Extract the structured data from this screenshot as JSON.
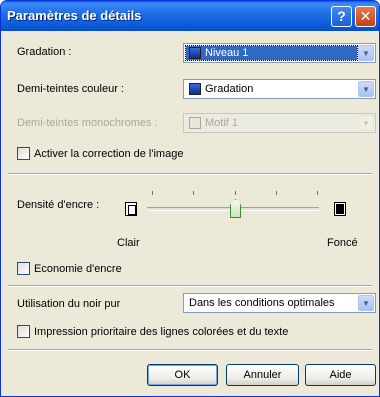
{
  "window": {
    "title": "Paramètres de détails",
    "help_glyph": "?",
    "close_glyph": "✕"
  },
  "gradation": {
    "label": "Gradation :",
    "value": "Niveau 1"
  },
  "demi_couleur": {
    "label": "Demi-teintes couleur :",
    "value": "Gradation"
  },
  "demi_mono": {
    "label": "Demi-teintes monochromes :",
    "value": "Motif 1"
  },
  "image_correction": {
    "label": "Activer la correction de l'image"
  },
  "density": {
    "label": "Densité d'encre :",
    "light": "Clair",
    "dark": "Foncé"
  },
  "eco": {
    "label": "Economie d'encre"
  },
  "black": {
    "label": "Utilisation du noir pur",
    "value": "Dans les conditions optimales"
  },
  "priority": {
    "label": "Impression prioritaire des lignes colorées et du texte"
  },
  "buttons": {
    "ok": "OK",
    "cancel": "Annuler",
    "help": "Aide"
  },
  "icons": {
    "combo_arrow": "▼"
  }
}
